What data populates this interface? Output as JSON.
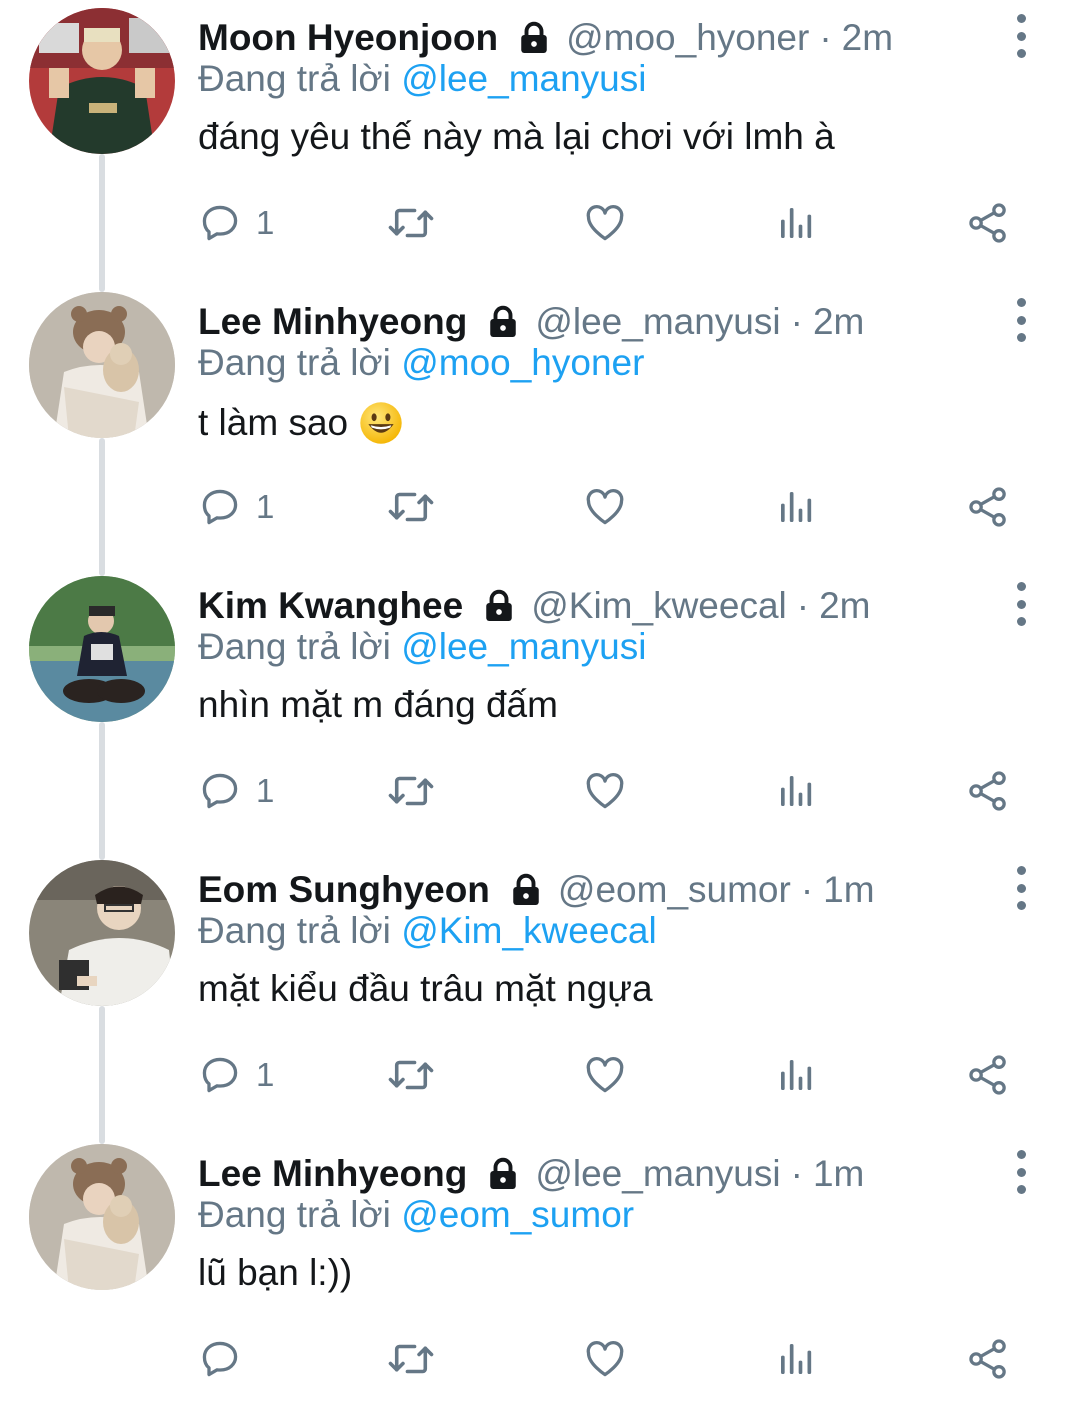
{
  "thread": {
    "reply_prefix": "Đang trả lời ",
    "tweets": [
      {
        "name": "Moon Hyeonjoon",
        "handle": "@moo_hyoner",
        "time": "2m",
        "reply_to": "@lee_manyusi",
        "text": "đáng yêu thế này mà lại chơi với lmh à",
        "emoji": "",
        "reply_count": "1",
        "avatar": "avatar-moon-hyeonjoon"
      },
      {
        "name": "Lee Minhyeong",
        "handle": "@lee_manyusi",
        "time": "2m",
        "reply_to": "@moo_hyoner",
        "text": "t làm sao",
        "emoji": "grinning-face-emoji",
        "reply_count": "1",
        "avatar": "avatar-lee-minhyeong"
      },
      {
        "name": "Kim Kwanghee",
        "handle": "@Kim_kweecal",
        "time": "2m",
        "reply_to": "@lee_manyusi",
        "text": "nhìn mặt m đáng đấm",
        "emoji": "",
        "reply_count": "1",
        "avatar": "avatar-kim-kwanghee"
      },
      {
        "name": "Eom Sunghyeon",
        "handle": "@eom_sumor",
        "time": "1m",
        "reply_to": "@Kim_kweecal",
        "text": "mặt kiểu đầu trâu mặt ngựa",
        "emoji": "",
        "reply_count": "1",
        "avatar": "avatar-eom-sunghyeon"
      },
      {
        "name": "Lee Minhyeong",
        "handle": "@lee_manyusi",
        "time": "1m",
        "reply_to": "@eom_sumor",
        "text": "lũ bạn l:))",
        "emoji": "",
        "reply_count": "",
        "avatar": "avatar-lee-minhyeong"
      }
    ]
  },
  "icons": {
    "lock": "lock-icon",
    "reply": "reply-icon",
    "retweet": "retweet-icon",
    "like": "heart-icon",
    "analytics": "analytics-icon",
    "share": "share-icon",
    "more": "more-vertical-icon"
  },
  "colors": {
    "text": "#14171a",
    "secondary": "#657786",
    "mention": "#1da1f2",
    "thread_line": "#d9dde1"
  }
}
